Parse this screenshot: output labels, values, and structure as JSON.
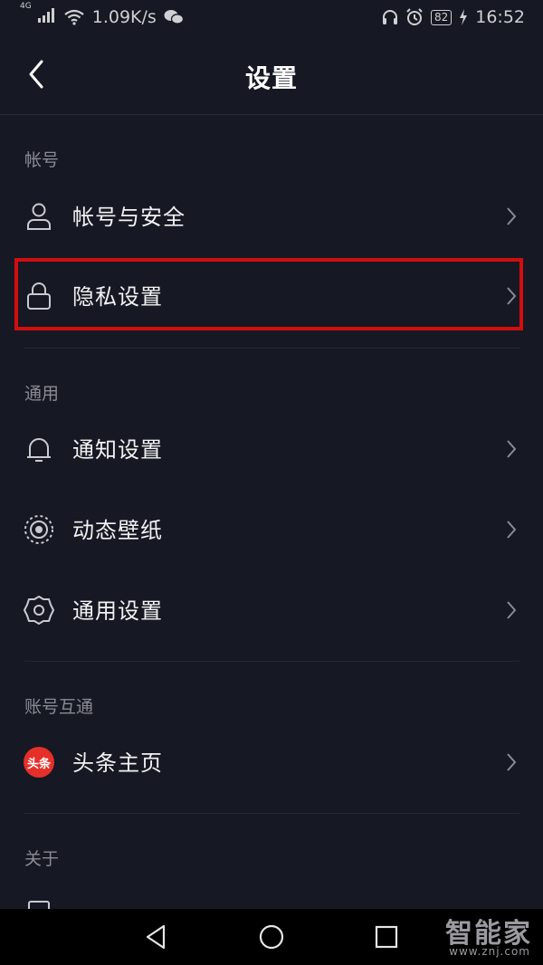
{
  "status_bar": {
    "signal_label": "4G",
    "speed": "1.09K/s",
    "battery": "82",
    "time": "16:52",
    "icons": [
      "signal-icon",
      "wifi-icon",
      "wechat-icon",
      "headphone-icon",
      "alarm-icon",
      "battery-icon",
      "charging-icon"
    ]
  },
  "header": {
    "title": "设置"
  },
  "sections": [
    {
      "title": "帐号"
    },
    {
      "title": "通用"
    },
    {
      "title": "账号互通"
    },
    {
      "title": "关于"
    }
  ],
  "items": [
    {
      "label": "帐号与安全",
      "icon": "person-icon"
    },
    {
      "label": "隐私设置",
      "icon": "lock-icon",
      "highlighted": true
    },
    {
      "label": "通知设置",
      "icon": "bell-icon"
    },
    {
      "label": "动态壁纸",
      "icon": "live-wallpaper-icon"
    },
    {
      "label": "通用设置",
      "icon": "gear-icon"
    },
    {
      "label": "头条主页",
      "icon": "toutiao-logo",
      "logo_text": "头条"
    }
  ],
  "highlight_color": "#d10e0e",
  "watermark": {
    "text": "智能家",
    "url": "www.znj.com"
  }
}
